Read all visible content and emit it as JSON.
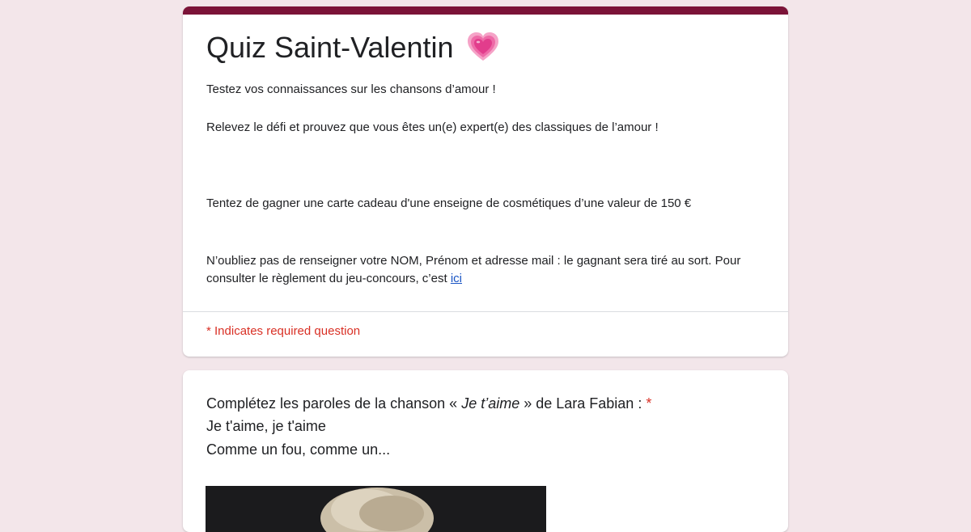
{
  "form": {
    "title": "Quiz Saint-Valentin",
    "title_emoji": "growing-heart-icon",
    "description": {
      "line1": "Testez vos connaissances sur les chansons d’amour !",
      "line2": "Relevez le défi et prouvez que vous êtes un(e) expert(e) des classiques de l’amour !",
      "line3": "Tentez de gagner une carte cadeau d'une enseigne de cosmétiques d’une valeur de 150 €",
      "line4_text": "N’oubliez pas de renseigner votre NOM, Prénom et adresse mail : le gagnant sera tiré au sort. Pour consulter le règlement du jeu-concours, c’est ",
      "line4_link": "ici"
    },
    "required_note": "* Indicates required question",
    "accent_color": "#7b1338",
    "background_color": "#f3e6ea"
  },
  "question1": {
    "prompt_prefix": "Complétez les paroles de la chanson  « ",
    "prompt_song": "Je t’aime",
    "prompt_suffix": " » de Lara Fabian  : ",
    "required_star": "*",
    "lyric_line1": "Je t'aime, je t'aime",
    "lyric_line2": "Comme un fou, comme un..."
  }
}
